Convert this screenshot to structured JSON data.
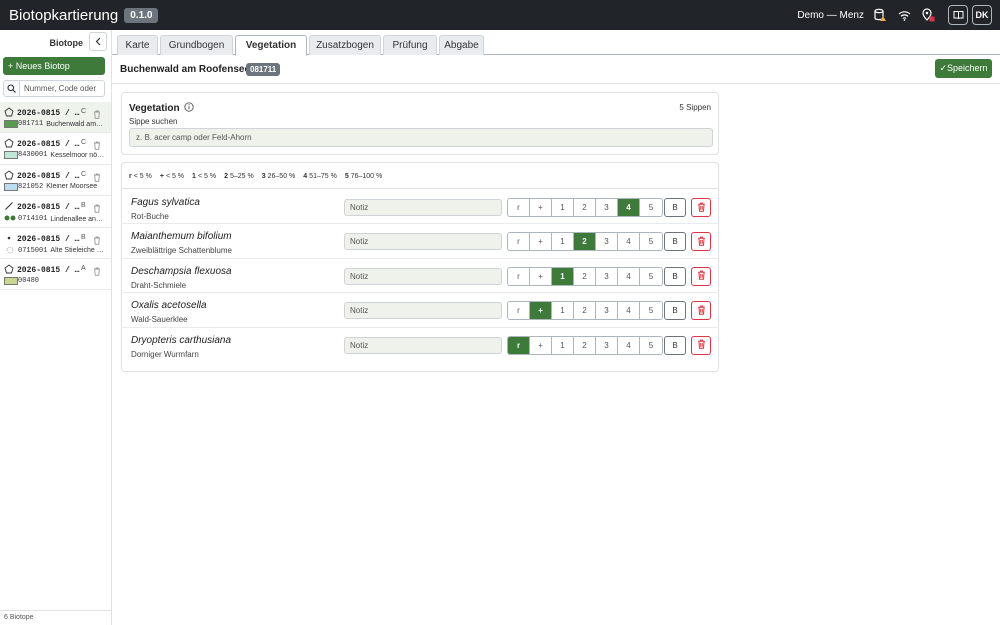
{
  "app": {
    "title": "Biotopkartierung",
    "version": "0.1.0",
    "user": "Demo — Menz",
    "avatar_initials": "DK"
  },
  "sidebar": {
    "title": "Biotope",
    "new_button": "+ Neues Biotop",
    "search_placeholder": "Nummer, Code oder",
    "footer": "6 Biotope",
    "items": [
      {
        "id": "2026-0815 / …",
        "letter": "C",
        "number": "081711",
        "name": "Buchenwald am…",
        "geom": "polygon",
        "swatch": "#5a9a4f"
      },
      {
        "id": "2026-0815 / …",
        "letter": "C",
        "number": "8430001",
        "name": "Kesselmoor nö…",
        "geom": "polygon",
        "swatch": "#bfe7d6"
      },
      {
        "id": "2026-0815 / …",
        "letter": "C",
        "number": "821052",
        "name": "Kleiner Moorsee",
        "geom": "polygon",
        "swatch": "#bcdcf2"
      },
      {
        "id": "2026-0815 / …",
        "letter": "B",
        "number": "0714101",
        "name": "Lindenallee an…",
        "geom": "line",
        "swatch": "#3e7a3a"
      },
      {
        "id": "2026-0815 / …",
        "letter": "B",
        "number": "0715001",
        "name": "Alte Stieleiche …",
        "geom": "point",
        "swatch": "#999999"
      },
      {
        "id": "2026-0815 / …",
        "letter": "A",
        "number": "00480",
        "name": "",
        "geom": "polygon",
        "swatch": "#c9d88f"
      }
    ]
  },
  "tabs": [
    "Karte",
    "Grundbogen",
    "Vegetation",
    "Zusatzbogen",
    "Prüfung",
    "Abgabe"
  ],
  "active_tab": "Vegetation",
  "header": {
    "biotop_name": "Buchenwald am Roofensee",
    "biotop_number": "081711",
    "save_label": "✓Speichern"
  },
  "vegetation": {
    "title": "Vegetation",
    "count": "5 Sippen",
    "search_label": "Sippe suchen",
    "search_placeholder": "z. B. acer camp oder Feld-Ahorn",
    "legend": [
      {
        "key": "r",
        "text": "< 5 %"
      },
      {
        "key": "+",
        "text": "< 5 %"
      },
      {
        "key": "1",
        "text": "< 5 %"
      },
      {
        "key": "2",
        "text": "5–25 %"
      },
      {
        "key": "3",
        "text": "26–50 %"
      },
      {
        "key": "4",
        "text": "51–75 %"
      },
      {
        "key": "5",
        "text": "76–100 %"
      }
    ],
    "scale": [
      "r",
      "+",
      "1",
      "2",
      "3",
      "4",
      "5"
    ],
    "notiz_placeholder": "Notiz",
    "b_label": "B",
    "species": [
      {
        "scientific": "Fagus sylvatica",
        "common": "Rot-Buche",
        "cover": "4"
      },
      {
        "scientific": "Maianthemum bifolium",
        "common": "Zweiblättrige Schattenblume",
        "cover": "2"
      },
      {
        "scientific": "Deschampsia flexuosa",
        "common": "Draht-Schmiele",
        "cover": "1"
      },
      {
        "scientific": "Oxalis acetosella",
        "common": "Wald-Sauerklee",
        "cover": "+"
      },
      {
        "scientific": "Dryopteris carthusiana",
        "common": "Dorniger Wurmfarn",
        "cover": "r"
      }
    ]
  },
  "colors": {
    "accent": "#3e7a3a",
    "topbar": "#212529",
    "danger": "#dc3545"
  }
}
